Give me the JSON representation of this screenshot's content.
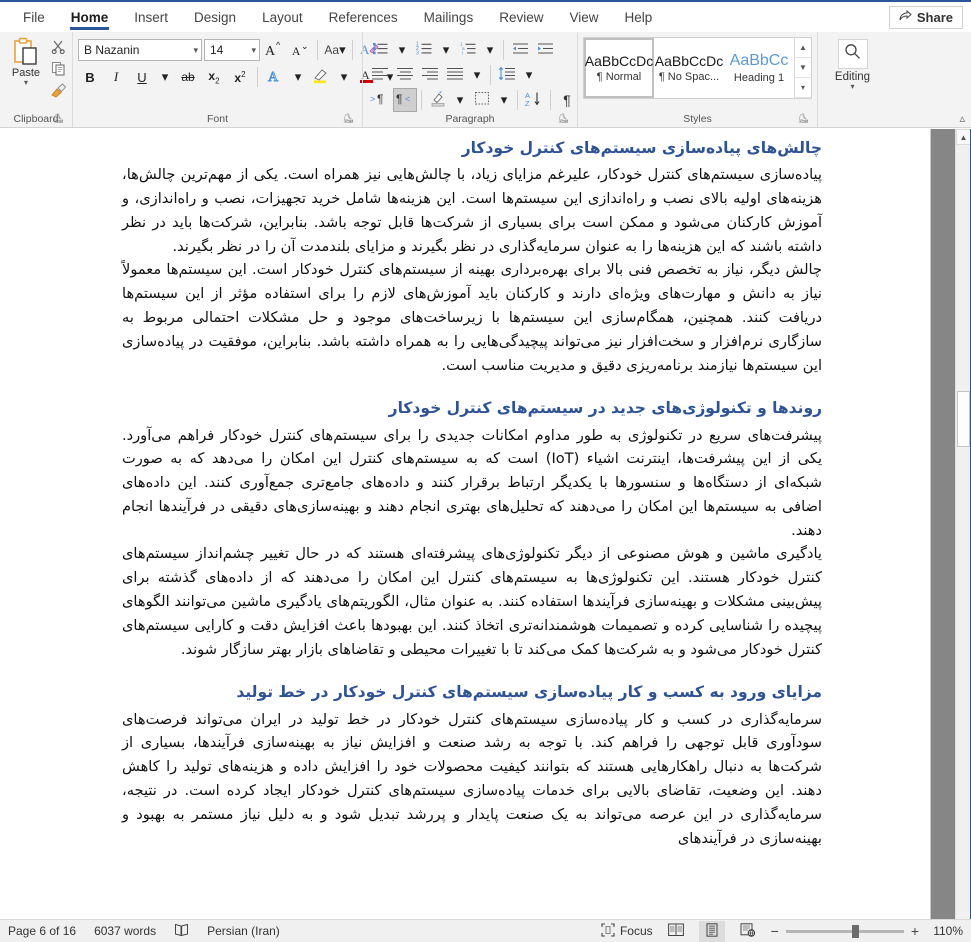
{
  "ribbon": {
    "tabs": [
      {
        "label": "File",
        "active": false
      },
      {
        "label": "Home",
        "active": true
      },
      {
        "label": "Insert",
        "active": false
      },
      {
        "label": "Design",
        "active": false
      },
      {
        "label": "Layout",
        "active": false
      },
      {
        "label": "References",
        "active": false
      },
      {
        "label": "Mailings",
        "active": false
      },
      {
        "label": "Review",
        "active": false
      },
      {
        "label": "View",
        "active": false
      },
      {
        "label": "Help",
        "active": false
      }
    ],
    "share_label": "Share",
    "groups": {
      "clipboard": {
        "label": "Clipboard",
        "paste_label": "Paste",
        "cut_icon": "scissors-icon",
        "copy_icon": "copy-icon",
        "format_painter_icon": "format-painter-icon"
      },
      "font": {
        "label": "Font",
        "font_name": "B Nazanin",
        "font_size": "14",
        "grow_font": "A",
        "shrink_font": "A",
        "change_case": "Aa",
        "clear_formatting": "A",
        "bold": "B",
        "italic": "I",
        "underline": "U",
        "strikethrough": "ab",
        "subscript": "x",
        "superscript": "x",
        "text_effects": "A",
        "highlight": "A",
        "font_color": "A"
      },
      "paragraph": {
        "label": "Paragraph",
        "buttons": [
          "bullets",
          "numbering",
          "multilevel-list",
          "decrease-indent",
          "increase-indent",
          "align-left",
          "center",
          "align-right",
          "justify",
          "line-spacing",
          "ltr-text-direction",
          "rtl-text-direction",
          "shading",
          "borders",
          "sort",
          "show-formatting-marks"
        ],
        "rtl_active": true
      },
      "styles": {
        "label": "Styles",
        "items": [
          {
            "preview": "AaBbCcDc",
            "name": "¶ Normal",
            "selected": true
          },
          {
            "preview": "AaBbCcDc",
            "name": "¶ No Spac...",
            "selected": false
          },
          {
            "preview": "AaBbCс",
            "name": "Heading 1",
            "selected": false
          }
        ]
      },
      "editing": {
        "label": "Editing",
        "button_label": "Editing",
        "icon": "search-icon"
      }
    }
  },
  "document": {
    "blocks": [
      {
        "type": "heading",
        "text": "چالش‌های پیاده‌سازی سیستم‌های کنترل خودکار"
      },
      {
        "type": "paragraph",
        "text": "پیاده‌سازی سیستم‌های کنترل خودکار، علیرغم مزایای زیاد، با چالش‌هایی نیز همراه است. یکی از مهم‌ترین چالش‌ها، هزینه‌های اولیه بالای نصب و راه‌اندازی این سیستم‌ها است. این هزینه‌ها شامل خرید تجهیزات، نصب و راه‌اندازی، و آموزش کارکنان می‌شود و ممکن است برای بسیاری از شرکت‌ها قابل توجه باشد. بنابراین، شرکت‌ها باید در نظر داشته باشند که این هزینه‌ها را به عنوان سرمایه‌گذاری در نظر بگیرند و مزایای بلندمدت آن را در نظر بگیرند."
      },
      {
        "type": "paragraph",
        "text": "چالش دیگر، نیاز به تخصص فنی بالا برای بهره‌برداری بهینه از سیستم‌های کنترل خودکار است. این سیستم‌ها معمولاً نیاز به دانش و مهارت‌های ویژه‌ای دارند و کارکنان باید آموزش‌های لازم را برای استفاده مؤثر از این سیستم‌ها دریافت کنند. همچنین، همگام‌سازی این سیستم‌ها با زیرساخت‌های موجود و حل مشکلات احتمالی مربوط به سازگاری نرم‌افزار و سخت‌افزار نیز می‌تواند پیچیدگی‌هایی را به همراه داشته باشد. بنابراین، موفقیت در پیاده‌سازی این سیستم‌ها نیازمند برنامه‌ریزی دقیق و مدیریت مناسب است."
      },
      {
        "type": "heading",
        "text": "روندها و تکنولوژی‌های جدید در سیستم‌های کنترل خودکار"
      },
      {
        "type": "paragraph",
        "text": "پیشرفت‌های سریع در تکنولوژی به طور مداوم امکانات جدیدی را برای سیستم‌های کنترل خودکار فراهم می‌آورد. یکی از این پیشرفت‌ها، اینترنت اشیاء (IoT) است که به سیستم‌های کنترل این امکان را می‌دهد که به صورت شبکه‌ای از دستگاه‌ها و سنسورها با یکدیگر ارتباط برقرار کنند و داده‌های جامع‌تری جمع‌آوری کنند. این داده‌های اضافی به سیستم‌ها این امکان را می‌دهند که تحلیل‌های بهتری انجام دهند و بهینه‌سازی‌های دقیقی در فرآیندها انجام دهند."
      },
      {
        "type": "paragraph",
        "text": "یادگیری ماشین و هوش مصنوعی از دیگر تکنولوژی‌های پیشرفته‌ای هستند که در حال تغییر چشم‌انداز سیستم‌های کنترل خودکار هستند. این تکنولوژی‌ها به سیستم‌های کنترل این امکان را می‌دهند که از داده‌های گذشته برای پیش‌بینی مشکلات و بهینه‌سازی فرآیندها استفاده کنند. به عنوان مثال، الگوریتم‌های یادگیری ماشین می‌توانند الگوهای پیچیده را شناسایی کرده و تصمیمات هوشمندانه‌تری اتخاذ کنند. این بهبودها باعث افزایش دقت و کارایی سیستم‌های کنترل خودکار می‌شود و به شرکت‌ها کمک می‌کند تا با تغییرات محیطی و تقاضاهای بازار بهتر سازگار شوند."
      },
      {
        "type": "heading",
        "text": "مزایای ورود به کسب و کار پیاده‌سازی سیستم‌های کنترل خودکار در خط تولید"
      },
      {
        "type": "paragraph",
        "text": "سرمایه‌گذاری در کسب و کار پیاده‌سازی سیستم‌های کنترل خودکار در خط تولید در ایران می‌تواند فرصت‌های سودآوری قابل توجهی را فراهم کند. با توجه به رشد صنعت و افزایش نیاز به بهینه‌سازی فرآیندها، بسیاری از شرکت‌ها به دنبال راهکارهایی هستند که بتوانند کیفیت محصولات خود را افزایش داده و هزینه‌های تولید را کاهش دهند. این وضعیت، تقاضای بالایی برای خدمات پیاده‌سازی سیستم‌های کنترل خودکار ایجاد کرده است. در نتیجه، سرمایه‌گذاری در این عرصه می‌تواند به یک صنعت پایدار و پررشد تبدیل شود و به دلیل نیاز مستمر به بهبود و بهینه‌سازی در فرآیندهای"
      }
    ]
  },
  "statusbar": {
    "page_label": "Page 6 of 16",
    "word_count": "6037 words",
    "proofing_icon": "proofing-errors-icon",
    "language": "Persian (Iran)",
    "focus_label": "Focus",
    "views": [
      {
        "name": "read-mode-view",
        "active": false
      },
      {
        "name": "print-layout-view",
        "active": true
      },
      {
        "name": "web-layout-view",
        "active": false
      }
    ],
    "zoom_out": "−",
    "zoom_in": "+",
    "zoom_level": "110%"
  }
}
